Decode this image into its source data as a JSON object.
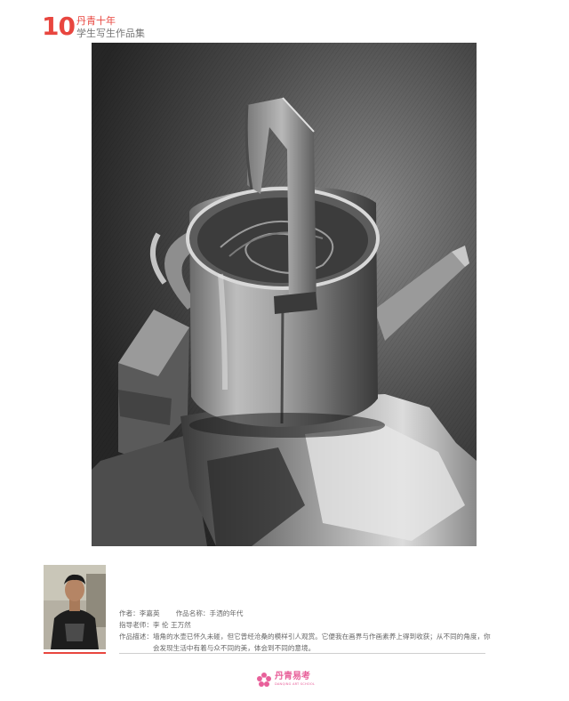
{
  "header": {
    "logo_number": "10",
    "logo_title": "丹青十年",
    "logo_subtitle": "学生写生作品集"
  },
  "artwork": {
    "subject": "watering-can-charcoal-sketch"
  },
  "author_info": {
    "author_label": "作者：",
    "author_name": "李嘉英",
    "title_label": "作品名称：",
    "title": "手洒的年代",
    "teacher_label": "指导老师：",
    "teacher_names": "李    伦    王万然",
    "desc_label": "作品描述：",
    "description": "墙角的水壶已怀久未碰，但它曾经沧桑的模样引人观赏。它便我在画界与作画素养上得到收获；从不同的角度，你会发现生活中有着与众不同的美，体会到不同的意境。"
  },
  "footer": {
    "brand_name": "丹青易考",
    "brand_sub": "DANQING ART SCHOOL"
  },
  "colors": {
    "accent_red": "#e8463f",
    "brand_pink": "#e8609a"
  }
}
